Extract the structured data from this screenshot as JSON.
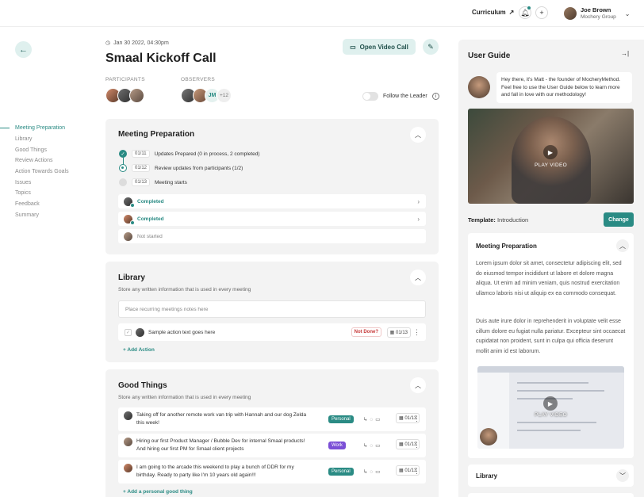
{
  "topbar": {
    "curriculum_label": "Curriculum",
    "add_label": "+",
    "user_name": "Joe Brown",
    "user_org": "Mochery Group"
  },
  "meeting": {
    "date": "Jan 30 2022, 04:30pm",
    "title": "Smaal Kickoff Call",
    "open_call_label": "Open Video Call",
    "participants_label": "PARTICIPANTS",
    "observers_label": "OBSERVERS",
    "observer_initials": "JM",
    "observer_more": "+12",
    "follow_label": "Follow the Leader"
  },
  "nav": {
    "items": [
      "Meeting Preparation",
      "Library",
      "Good Things",
      "Review Actions",
      "Action Towards Goals",
      "Issues",
      "Topics",
      "Feedback",
      "Summary"
    ]
  },
  "prep": {
    "title": "Meeting Preparation",
    "steps": [
      {
        "num": "01/11",
        "text": "Updates Prepared (0 in process, 2 completed)"
      },
      {
        "num": "01/12",
        "text": "Review updates from participants (1/2)"
      },
      {
        "num": "01/13",
        "text": "Meeting starts"
      }
    ],
    "rows": [
      {
        "status": "Completed"
      },
      {
        "status": "Completed"
      },
      {
        "status": "Not started"
      }
    ]
  },
  "library": {
    "title": "Library",
    "subtitle": "Store any written information that is used in every meeting",
    "placeholder": "Place recurring meetings notes here",
    "action_text": "Sample action text goes here",
    "not_done": "Not Done?",
    "action_date": "01/13",
    "add_action": "Add Action"
  },
  "good_things": {
    "title": "Good Things",
    "subtitle": "Store any written information that is used in every meeting",
    "items": [
      {
        "text": "Taking off for another remote work van trip with Hannah and our dog Zelda this week!",
        "tag": "Personal",
        "date": "01/13"
      },
      {
        "text": "Hiring our first Product Manager / Bubble Dev for internal Smaal products! And hiring our first PM for Smaal client projects",
        "tag": "Work",
        "date": "01/13"
      },
      {
        "text": "I am going to the arcade this weekend to play a bunch of DDR for my birthday. Ready to party like I'm 10 years old again!!!",
        "tag": "Personal",
        "date": "01/13"
      }
    ],
    "add_label": "Add a personal good thing"
  },
  "guide": {
    "title": "User Guide",
    "intro": "Hey there, it's Matt - the founder of MocheryMethod. Feel free to use the User Guide below to learn more and fall in love with our methodology!",
    "play_label": "PLAY VIDEO",
    "template_label": "Template:",
    "template_value": "Introduction",
    "change_label": "Change",
    "section_title": "Meeting Preparation",
    "para1": "Lorem ipsum dolor sit amet, consectetur adipiscing elit, sed do eiusmod tempor incididunt ut labore et dolore magna aliqua. Ut enim ad minim veniam, quis nostrud exercitation ullamco laboris nisi ut aliquip ex ea commodo consequat.",
    "para2": "Duis aute irure dolor in reprehenderit in voluptate velit esse cillum dolore eu fugiat nulla pariatur. Excepteur sint occaecat cupidatat non proident, sunt in culpa qui officia deserunt mollit anim id est laborum.",
    "video2_label": "PLAY VIDEO",
    "library_title": "Library"
  },
  "colors": {
    "accent": "#2a8b84",
    "work_tag": "#7b4fd6",
    "personal_tag": "#2a8b84",
    "not_done": "#c73939"
  }
}
